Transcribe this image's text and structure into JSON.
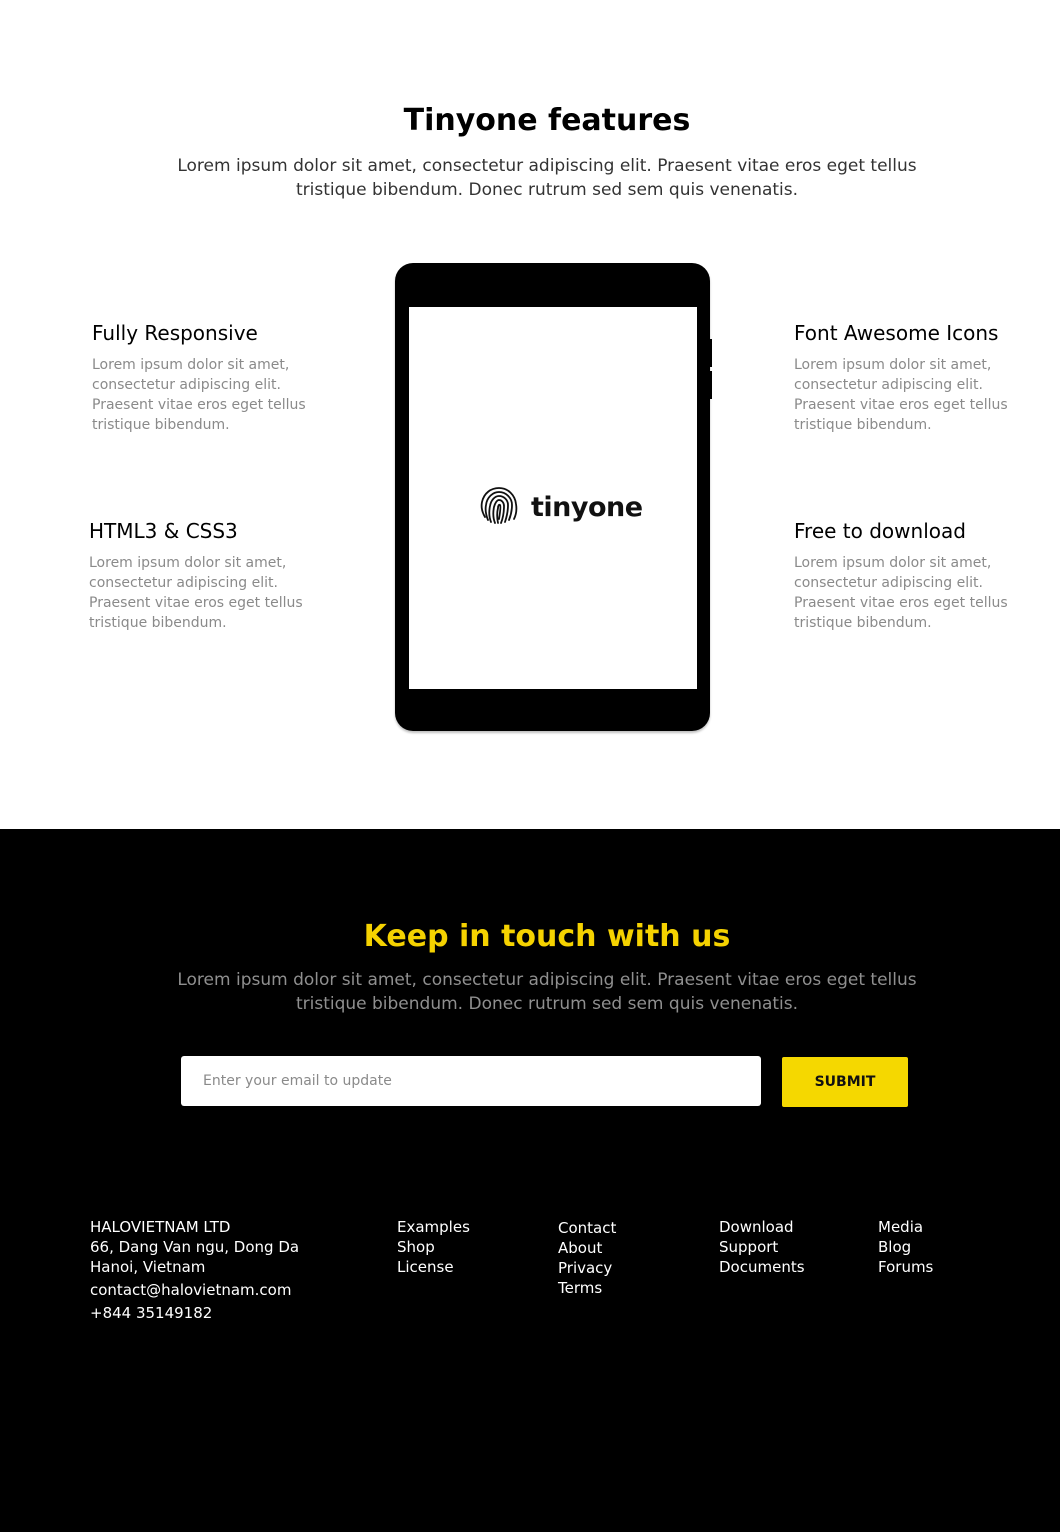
{
  "features": {
    "title": "Tinyone features",
    "subtitle": "Lorem ipsum dolor sit amet, consectetur adipiscing elit. Praesent vitae eros eget tellus tristique bibendum. Donec rutrum sed sem quis venenatis.",
    "items": [
      {
        "title": "Fully Responsive",
        "text": "Lorem ipsum dolor sit amet, consectetur adipiscing elit. Praesent vitae eros eget tellus tristique bibendum."
      },
      {
        "title": "HTML3 & CSS3",
        "text": "Lorem ipsum dolor sit amet, consectetur adipiscing elit. Praesent vitae eros eget tellus tristique bibendum."
      },
      {
        "title": "Font Awesome Icons",
        "text": "Lorem ipsum dolor sit amet, consectetur adipiscing elit. Praesent vitae eros eget tellus tristique bibendum."
      },
      {
        "title": "Free to download",
        "text": "Lorem ipsum dolor sit amet, consectetur adipiscing elit. Praesent vitae eros eget tellus tristique bibendum."
      }
    ],
    "logo_text": "tinyone",
    "logo_icon": "fingerprint-icon"
  },
  "contact": {
    "title": "Keep in touch with us",
    "subtitle": "Lorem ipsum dolor sit amet, consectetur adipiscing elit. Praesent vitae eros eget tellus tristique bibendum. Donec rutrum sed sem quis venenatis.",
    "email_placeholder": "Enter your email to update",
    "submit_label": "SUBMIT"
  },
  "footer": {
    "company": "HALOVIETNAM LTD",
    "address_line1": "66, Dang Van ngu, Dong Da",
    "address_line2": "Hanoi, Vietnam",
    "email": "contact@halovietnam.com",
    "phone": "+844 35149182",
    "columns": [
      [
        "Examples",
        "Shop",
        "License"
      ],
      [
        "Contact",
        "About",
        "Privacy",
        "Terms"
      ],
      [
        "Download",
        "Support",
        "Documents"
      ],
      [
        "Media",
        "Blog",
        "Forums"
      ]
    ]
  },
  "colors": {
    "accent": "#f5d800",
    "dark_bg": "#000000"
  }
}
